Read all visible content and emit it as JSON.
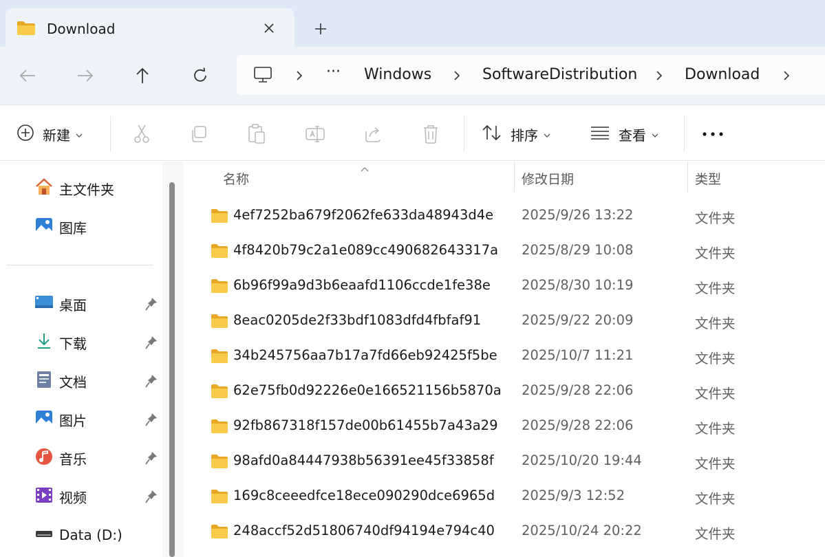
{
  "tab": {
    "title": "Download",
    "folder_icon": "folder-icon",
    "close_icon": "close-icon",
    "new_tab_icon": "plus-icon"
  },
  "nav": {
    "back_icon": "arrow-left-icon",
    "forward_icon": "arrow-right-icon",
    "up_icon": "arrow-up-icon",
    "refresh_icon": "refresh-icon"
  },
  "address": {
    "root_icon": "computer-icon",
    "overflow": "···",
    "crumbs": [
      "Windows",
      "SoftwareDistribution",
      "Download"
    ]
  },
  "commands": {
    "new_label": "新建",
    "sort_label": "排序",
    "view_label": "查看",
    "more": "···"
  },
  "sidebar": {
    "quick": [
      {
        "label": "主文件夹",
        "icon": "home-icon"
      },
      {
        "label": "图库",
        "icon": "gallery-icon"
      }
    ],
    "pinned": [
      {
        "label": "桌面",
        "icon": "desktop-icon"
      },
      {
        "label": "下载",
        "icon": "download-icon"
      },
      {
        "label": "文档",
        "icon": "document-icon"
      },
      {
        "label": "图片",
        "icon": "pictures-icon"
      },
      {
        "label": "音乐",
        "icon": "music-icon"
      },
      {
        "label": "视频",
        "icon": "video-icon"
      }
    ],
    "drives": [
      {
        "label": "Data (D:)",
        "icon": "drive-icon"
      }
    ]
  },
  "list": {
    "columns": {
      "name": "名称",
      "modified": "修改日期",
      "type": "类型"
    },
    "rows": [
      {
        "name": "4ef7252ba679f2062fe633da48943d4e",
        "modified": "2025/9/26 13:22",
        "type": "文件夹"
      },
      {
        "name": "4f8420b79c2a1e089cc490682643317a",
        "modified": "2025/8/29 10:08",
        "type": "文件夹"
      },
      {
        "name": "6b96f99a9d3b6eaafd1106ccde1fe38e",
        "modified": "2025/8/30 10:19",
        "type": "文件夹"
      },
      {
        "name": "8eac0205de2f33bdf1083dfd4fbfaf91",
        "modified": "2025/9/22 20:09",
        "type": "文件夹"
      },
      {
        "name": "34b245756aa7b17a7fd66eb92425f5be",
        "modified": "2025/10/7 11:21",
        "type": "文件夹"
      },
      {
        "name": "62e75fb0d92226e0e166521156b5870a",
        "modified": "2025/9/28 22:06",
        "type": "文件夹"
      },
      {
        "name": "92fb867318f157de00b61455b7a43a29",
        "modified": "2025/9/28 22:06",
        "type": "文件夹"
      },
      {
        "name": "98afd0a84447938b56391ee45f33858f",
        "modified": "2025/10/20 19:44",
        "type": "文件夹"
      },
      {
        "name": "169c8ceeedfce18ece090290dce6965d",
        "modified": "2025/9/3 12:52",
        "type": "文件夹"
      },
      {
        "name": "248accf52d51806740df94194e794c40",
        "modified": "2025/10/24 20:22",
        "type": "文件夹"
      }
    ]
  },
  "colors": {
    "tabbar_bg": "#dfe9f5",
    "nav_bg": "#eef3fa",
    "folder_yellow": "#f8cb4a",
    "accent": "#0067c0"
  }
}
